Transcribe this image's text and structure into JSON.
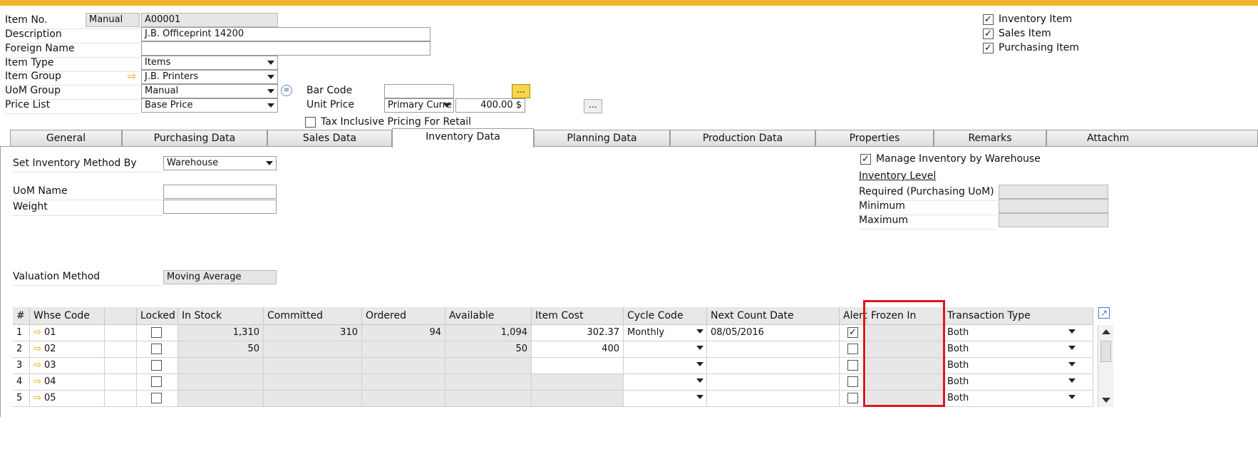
{
  "header": {
    "item_no_label": "Item No.",
    "item_no_mode": "Manual",
    "item_no_value": "A00001",
    "description_label": "Description",
    "description_value": "J.B. Officeprint 14200",
    "foreign_name_label": "Foreign Name",
    "foreign_name_value": "",
    "item_type_label": "Item Type",
    "item_type_value": "Items",
    "item_group_label": "Item Group",
    "item_group_value": "J.B. Printers",
    "uom_group_label": "UoM Group",
    "uom_group_value": "Manual",
    "price_list_label": "Price List",
    "price_list_value": "Base Price",
    "bar_code_label": "Bar Code",
    "bar_code_value": "",
    "unit_price_label": "Unit Price",
    "unit_price_currency": "Primary Curre",
    "unit_price_value": "400.00 $",
    "tax_inclusive_label": "Tax Inclusive Pricing For Retail",
    "ellipsis": "...",
    "inventory_item_label": "Inventory Item",
    "sales_item_label": "Sales Item",
    "purchasing_item_label": "Purchasing Item"
  },
  "tabs": [
    {
      "label": "General"
    },
    {
      "label": "Purchasing Data"
    },
    {
      "label": "Sales Data"
    },
    {
      "label": "Inventory Data"
    },
    {
      "label": "Planning Data"
    },
    {
      "label": "Production Data"
    },
    {
      "label": "Properties"
    },
    {
      "label": "Remarks"
    },
    {
      "label": "Attachm"
    }
  ],
  "inventory": {
    "set_method_label": "Set Inventory Method By",
    "set_method_value": "Warehouse",
    "uom_name_label": "UoM Name",
    "weight_label": "Weight",
    "valuation_label": "Valuation Method",
    "valuation_value": "Moving Average",
    "manage_by_wh_label": "Manage Inventory by Warehouse",
    "inventory_level_label": "Inventory Level",
    "required_label": "Required (Purchasing UoM)",
    "minimum_label": "Minimum",
    "maximum_label": "Maximum"
  },
  "grid": {
    "headers": [
      "#",
      "Whse Code",
      "",
      "Locked",
      "In Stock",
      "Committed",
      "Ordered",
      "Available",
      "Item Cost",
      "Cycle Code",
      "Next Count Date",
      "Alert",
      "Frozen In",
      "Transaction Type"
    ],
    "rows": [
      {
        "n": "1",
        "whse": "01",
        "in_stock": "1,310",
        "committed": "310",
        "ordered": "94",
        "available": "1,094",
        "item_cost": "302.37",
        "cycle": "Monthly",
        "next_count": "08/05/2016",
        "alert": true,
        "txn": "Both"
      },
      {
        "n": "2",
        "whse": "02",
        "in_stock": "50",
        "committed": "",
        "ordered": "",
        "available": "50",
        "item_cost": "400",
        "cycle": "",
        "next_count": "",
        "alert": false,
        "txn": "Both"
      },
      {
        "n": "3",
        "whse": "03",
        "in_stock": "",
        "committed": "",
        "ordered": "",
        "available": "",
        "item_cost": "",
        "cycle": "",
        "next_count": "",
        "alert": false,
        "txn": "Both"
      },
      {
        "n": "4",
        "whse": "04",
        "in_stock": "",
        "committed": "",
        "ordered": "",
        "available": "",
        "item_cost": "",
        "cycle": "",
        "next_count": "",
        "alert": false,
        "txn": "Both"
      },
      {
        "n": "5",
        "whse": "05",
        "in_stock": "",
        "committed": "",
        "ordered": "",
        "available": "",
        "item_cost": "",
        "cycle": "",
        "next_count": "",
        "alert": false,
        "txn": "Both"
      }
    ]
  },
  "colors": {
    "top_accent": "#f2b42c",
    "highlight_box": "#e0141c",
    "link_arrow": "#e1a600"
  }
}
